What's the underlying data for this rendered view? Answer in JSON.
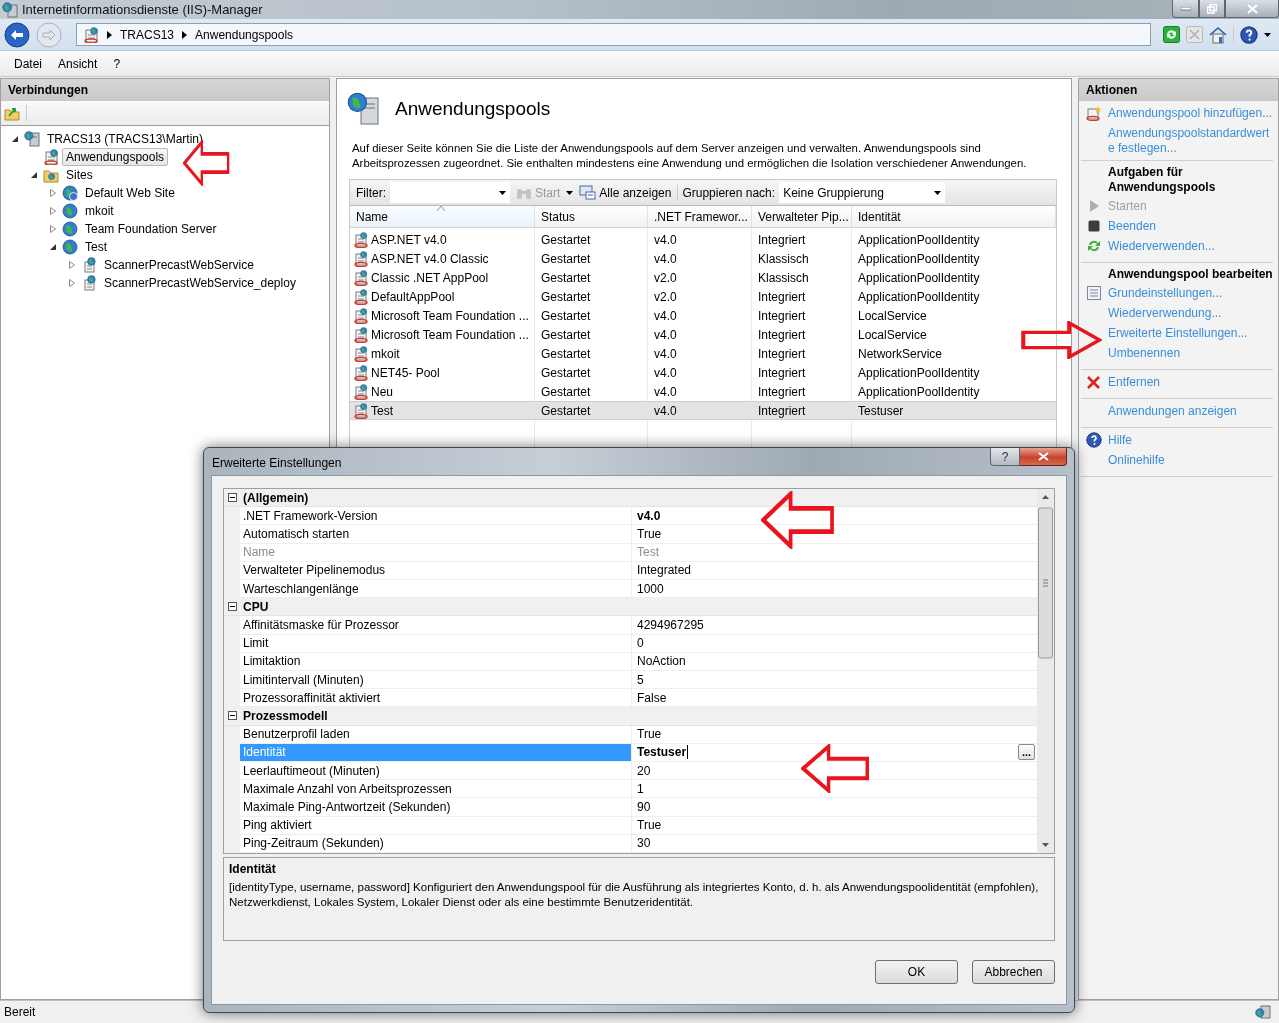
{
  "window": {
    "title": "Internetinformationsdienste (IIS)-Manager"
  },
  "address_bar": {
    "path": [
      "TRACS13",
      "Anwendungspools"
    ]
  },
  "menu": [
    "Datei",
    "Ansicht",
    "?"
  ],
  "connections": {
    "title": "Verbindungen",
    "tree": [
      {
        "label": "TRACS13 (TRACS13\\Martin)",
        "kind": "server",
        "expanded": true,
        "selected": false,
        "children": [
          {
            "label": "Anwendungspools",
            "kind": "pools",
            "selected": true
          },
          {
            "label": "Sites",
            "kind": "sites",
            "expanded": true,
            "selected": false,
            "children": [
              {
                "label": "Default Web Site",
                "kind": "default-site",
                "expanded": false,
                "selected": false
              },
              {
                "label": "mkoit",
                "kind": "site",
                "expanded": false,
                "selected": false
              },
              {
                "label": "Team Foundation Server",
                "kind": "site",
                "expanded": false,
                "selected": false
              },
              {
                "label": "Test",
                "kind": "site",
                "expanded": true,
                "selected": false,
                "children": [
                  {
                    "label": "ScannerPrecastWebService",
                    "kind": "app",
                    "expanded": false,
                    "selected": false
                  },
                  {
                    "label": "ScannerPrecastWebService_deploy",
                    "kind": "app",
                    "expanded": false,
                    "selected": false
                  }
                ]
              }
            ]
          }
        ]
      }
    ]
  },
  "page": {
    "title": "Anwendungspools",
    "description": "Auf dieser Seite können Sie die Liste der Anwendungspools auf dem Server anzeigen und verwalten. Anwendungspools sind Arbeitsprozessen zugeordnet. Sie enthalten mindestens eine Anwendung und ermöglichen die Isolation verschiedener Anwendungen.",
    "toolbar": {
      "filter_label": "Filter:",
      "start": "Start",
      "show_all": "Alle anzeigen",
      "group_label": "Gruppieren nach:",
      "group_value": "Keine Gruppierung"
    },
    "columns": [
      {
        "label": "Name",
        "sorted": true
      },
      {
        "label": "Status",
        "sorted": false
      },
      {
        "label": ".NET Framewor...",
        "sorted": false
      },
      {
        "label": "Verwalteter Pip...",
        "sorted": false
      },
      {
        "label": "Identität",
        "sorted": false
      }
    ],
    "rows": [
      {
        "cells": [
          "ASP.NET v4.0",
          "Gestartet",
          "v4.0",
          "Integriert",
          "ApplicationPoolIdentity"
        ],
        "selected": false
      },
      {
        "cells": [
          "ASP.NET v4.0 Classic",
          "Gestartet",
          "v4.0",
          "Klassisch",
          "ApplicationPoolIdentity"
        ],
        "selected": false
      },
      {
        "cells": [
          "Classic .NET AppPool",
          "Gestartet",
          "v2.0",
          "Klassisch",
          "ApplicationPoolIdentity"
        ],
        "selected": false
      },
      {
        "cells": [
          "DefaultAppPool",
          "Gestartet",
          "v2.0",
          "Integriert",
          "ApplicationPoolIdentity"
        ],
        "selected": false
      },
      {
        "cells": [
          "Microsoft Team Foundation ...",
          "Gestartet",
          "v4.0",
          "Integriert",
          "LocalService"
        ],
        "selected": false
      },
      {
        "cells": [
          "Microsoft Team Foundation ...",
          "Gestartet",
          "v4.0",
          "Integriert",
          "LocalService"
        ],
        "selected": false
      },
      {
        "cells": [
          "mkoit",
          "Gestartet",
          "v4.0",
          "Integriert",
          "NetworkService"
        ],
        "selected": false
      },
      {
        "cells": [
          "NET45- Pool",
          "Gestartet",
          "v4.0",
          "Integriert",
          "ApplicationPoolIdentity"
        ],
        "selected": false
      },
      {
        "cells": [
          "Neu",
          "Gestartet",
          "v4.0",
          "Integriert",
          "ApplicationPoolIdentity"
        ],
        "selected": false
      },
      {
        "cells": [
          "Test",
          "Gestartet",
          "v4.0",
          "Integriert",
          "Testuser"
        ],
        "selected": true
      }
    ]
  },
  "actions": {
    "title": "Aktionen",
    "groups": [
      {
        "items": [
          {
            "label": "Anwendungspool hinzufügen...",
            "kind": "add",
            "disabled": false
          },
          {
            "label": "Anwendungspoolstandardwerte festlegen...",
            "kind": "plain",
            "disabled": false
          }
        ]
      },
      {
        "heading": "Aufgaben für Anwendungspools",
        "items": [
          {
            "label": "Starten",
            "kind": "play",
            "disabled": true
          },
          {
            "label": "Beenden",
            "kind": "stop",
            "disabled": false
          },
          {
            "label": "Wiederverwenden...",
            "kind": "recycle",
            "disabled": false
          }
        ]
      },
      {
        "heading": "Anwendungspool bearbeiten",
        "items": [
          {
            "label": "Grundeinstellungen...",
            "kind": "settings",
            "disabled": false
          },
          {
            "label": "Wiederverwendung...",
            "kind": "plain",
            "disabled": false
          },
          {
            "label": "Erweiterte Einstellungen...",
            "kind": "plain",
            "disabled": false
          },
          {
            "label": "Umbenennen",
            "kind": "plain",
            "disabled": false
          }
        ]
      },
      {
        "items": [
          {
            "label": "Entfernen",
            "kind": "delete",
            "disabled": false
          }
        ]
      },
      {
        "items": [
          {
            "label": "Anwendungen anzeigen",
            "kind": "plain",
            "disabled": false
          }
        ]
      },
      {
        "items": [
          {
            "label": "Hilfe",
            "kind": "help",
            "disabled": false
          },
          {
            "label": "Onlinehilfe",
            "kind": "plain",
            "disabled": false
          }
        ]
      }
    ]
  },
  "dialog": {
    "title": "Erweiterte Einstellungen",
    "help_label": "?",
    "sections": [
      {
        "title": "(Allgemein)",
        "expanded": true,
        "properties": [
          {
            "name": ".NET Framework-Version",
            "value": "v4.0",
            "bold": true,
            "disabled": false,
            "selected": false
          },
          {
            "name": "Automatisch starten",
            "value": "True",
            "bold": false,
            "disabled": false,
            "selected": false
          },
          {
            "name": "Name",
            "value": "Test",
            "bold": false,
            "disabled": true,
            "selected": false
          },
          {
            "name": "Verwalteter Pipelinemodus",
            "value": "Integrated",
            "bold": false,
            "disabled": false,
            "selected": false
          },
          {
            "name": "Warteschlangenlänge",
            "value": "1000",
            "bold": false,
            "disabled": false,
            "selected": false
          }
        ]
      },
      {
        "title": "CPU",
        "expanded": true,
        "properties": [
          {
            "name": "Affinitätsmaske für Prozessor",
            "value": "4294967295",
            "bold": false,
            "disabled": false,
            "selected": false
          },
          {
            "name": "Limit",
            "value": "0",
            "bold": false,
            "disabled": false,
            "selected": false
          },
          {
            "name": "Limitaktion",
            "value": "NoAction",
            "bold": false,
            "disabled": false,
            "selected": false
          },
          {
            "name": "Limitintervall (Minuten)",
            "value": "5",
            "bold": false,
            "disabled": false,
            "selected": false
          },
          {
            "name": "Prozessoraffinität aktiviert",
            "value": "False",
            "bold": false,
            "disabled": false,
            "selected": false
          }
        ]
      },
      {
        "title": "Prozessmodell",
        "expanded": true,
        "properties": [
          {
            "name": "Benutzerprofil laden",
            "value": "True",
            "bold": false,
            "disabled": false,
            "selected": false
          },
          {
            "name": "Identität",
            "value": "Testuser",
            "bold": true,
            "disabled": false,
            "selected": true,
            "button": "..."
          },
          {
            "name": "Leerlauftimeout (Minuten)",
            "value": "20",
            "bold": false,
            "disabled": false,
            "selected": false
          },
          {
            "name": "Maximale Anzahl von Arbeitsprozessen",
            "value": "1",
            "bold": false,
            "disabled": false,
            "selected": false
          },
          {
            "name": "Maximale Ping-Antwortzeit (Sekunden)",
            "value": "90",
            "bold": false,
            "disabled": false,
            "selected": false
          },
          {
            "name": "Ping aktiviert",
            "value": "True",
            "bold": false,
            "disabled": false,
            "selected": false
          },
          {
            "name": "Ping-Zeitraum (Sekunden)",
            "value": "30",
            "bold": false,
            "disabled": false,
            "selected": false
          }
        ]
      }
    ],
    "description": {
      "title": "Identität",
      "text": "[identityType, username, password] Konfiguriert den Anwendungspool für die Ausführung als integriertes Konto, d. h. als Anwendungspoolidentität (empfohlen), Netzwerkdienst, Lokales System, Lokaler Dienst oder als eine bestimmte Benutzeridentität."
    },
    "buttons": [
      "OK",
      "Abbrechen"
    ]
  },
  "status_bar": {
    "text": "Bereit"
  }
}
